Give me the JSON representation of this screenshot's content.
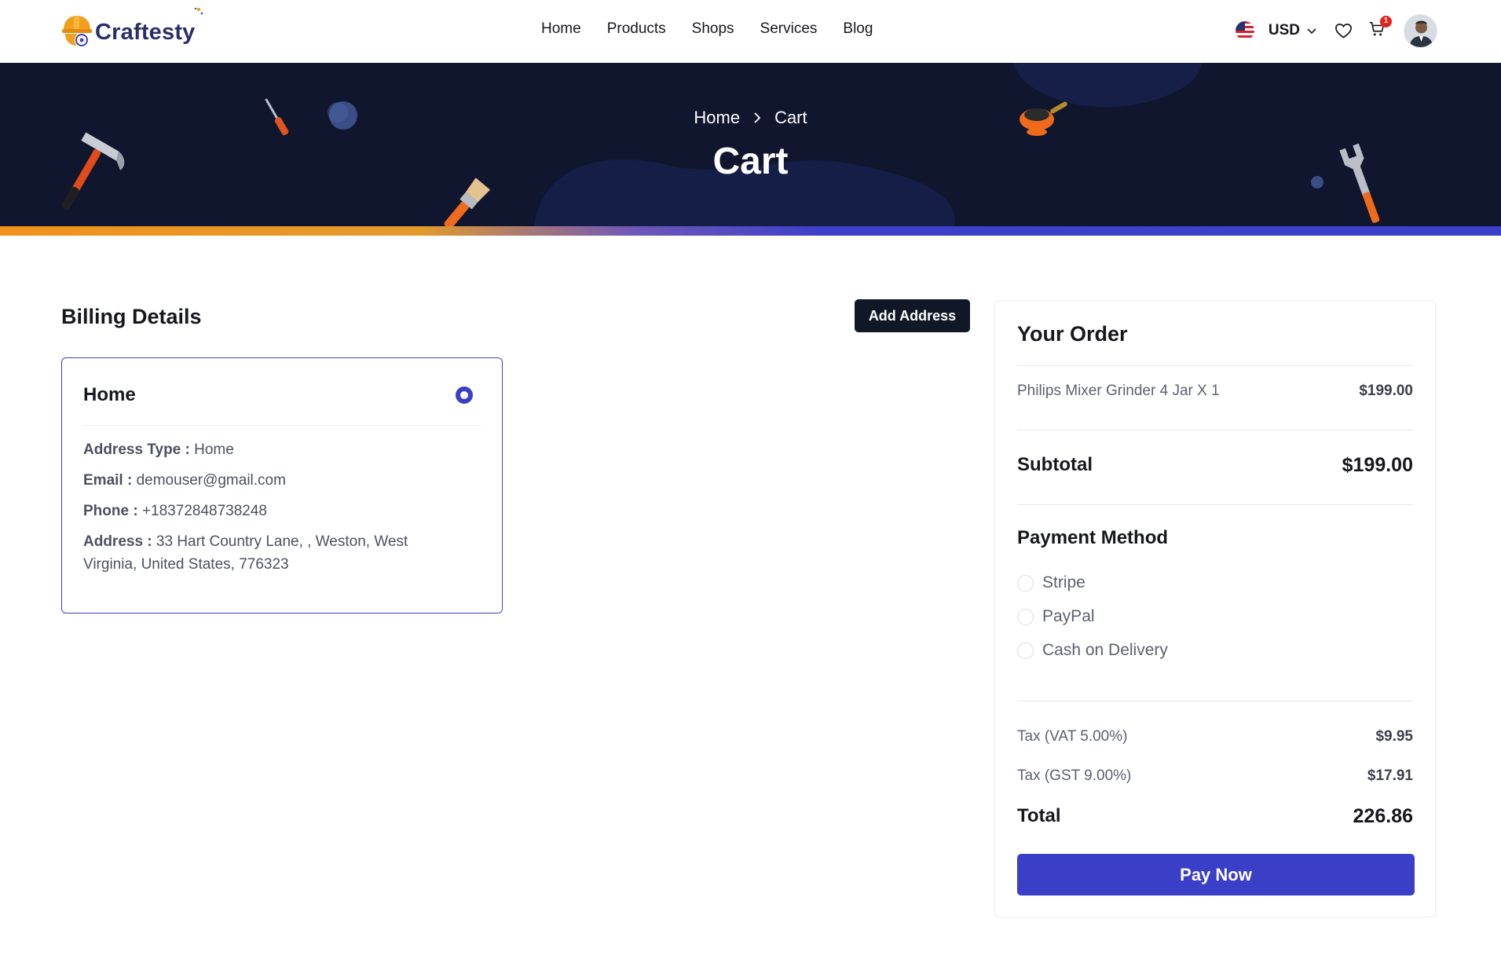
{
  "brand": {
    "name": "Craftesty"
  },
  "nav": {
    "links": [
      "Home",
      "Products",
      "Shops",
      "Services",
      "Blog"
    ],
    "currency": "USD",
    "cart_count": "1"
  },
  "hero": {
    "breadcrumb": {
      "home": "Home",
      "current": "Cart"
    },
    "title": "Cart"
  },
  "billing": {
    "title": "Billing Details",
    "add_address_label": "Add Address",
    "address": {
      "title": "Home",
      "type_label": "Address Type :",
      "type_value": "Home",
      "email_label": "Email :",
      "email_value": "demouser@gmail.com",
      "phone_label": "Phone :",
      "phone_value": "+18372848738248",
      "address_label": "Address :",
      "address_value": "33 Hart Country Lane, , Weston, West Virginia, United States, 776323"
    }
  },
  "order": {
    "title": "Your Order",
    "item": {
      "name": "Philips Mixer Grinder 4 Jar X 1",
      "price": "$199.00"
    },
    "subtotal_label": "Subtotal",
    "subtotal_value": "$199.00",
    "payment_title": "Payment Method",
    "payment_options": [
      "Stripe",
      "PayPal",
      "Cash on Delivery"
    ],
    "taxes": [
      {
        "label": "Tax (VAT 5.00%)",
        "value": "$9.95"
      },
      {
        "label": "Tax (GST 9.00%)",
        "value": "$17.91"
      }
    ],
    "total_label": "Total",
    "total_value": "226.86",
    "pay_label": "Pay Now"
  },
  "colors": {
    "accent": "#3b3fc8",
    "hero_bg": "#0f162d",
    "orange": "#f0921e",
    "dark_button": "#101828"
  }
}
